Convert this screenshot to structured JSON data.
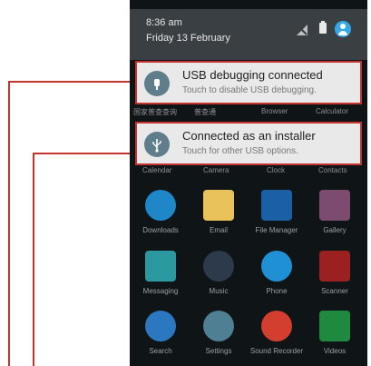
{
  "status": {
    "time": "8:36 am",
    "date": "Friday 13 February"
  },
  "notifications": [
    {
      "title": "USB debugging connected",
      "text": "Touch to disable USB debugging.",
      "icon": "usb-debug-icon"
    },
    {
      "title": "Connected as an installer",
      "text": "Touch for other USB options.",
      "icon": "usb-icon"
    }
  ],
  "partial_row_1": [
    "国家普查查询",
    "普查通",
    "Browser",
    "Calculator"
  ],
  "partial_row_2": [
    "Calendar",
    "Camera",
    "Clock",
    "Contacts"
  ],
  "apps": [
    {
      "label": "Downloads",
      "color": "#1f86c8",
      "icon": "download-icon"
    },
    {
      "label": "Email",
      "color": "#e9c35a",
      "icon": "email-icon"
    },
    {
      "label": "File Manager",
      "color": "#1b5fa6",
      "icon": "folder-icon"
    },
    {
      "label": "Gallery",
      "color": "#7d4b6f",
      "icon": "gallery-icon"
    },
    {
      "label": "Messaging",
      "color": "#2b9aa0",
      "icon": "message-icon"
    },
    {
      "label": "Music",
      "color": "#2d3a4c",
      "icon": "music-icon"
    },
    {
      "label": "Phone",
      "color": "#1f8fd6",
      "icon": "phone-icon"
    },
    {
      "label": "Scanner",
      "color": "#9b2020",
      "icon": "barcode-icon"
    },
    {
      "label": "Search",
      "color": "#2b78c0",
      "icon": "search-icon"
    },
    {
      "label": "Settings",
      "color": "#4f7f93",
      "icon": "gear-icon"
    },
    {
      "label": "Sound Recorder",
      "color": "#d43e2e",
      "icon": "mic-icon"
    },
    {
      "label": "Videos",
      "color": "#1f8a3f",
      "icon": "video-icon"
    }
  ]
}
